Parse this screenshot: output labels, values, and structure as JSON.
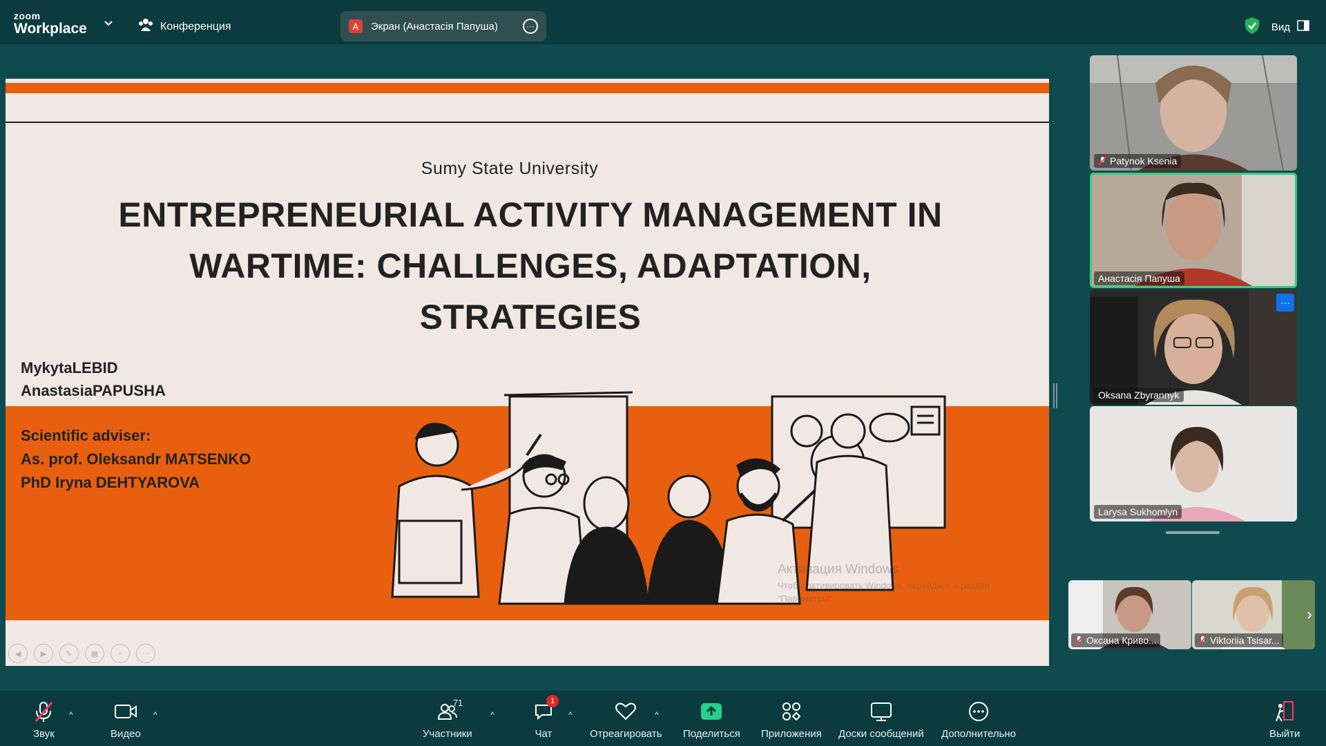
{
  "app": {
    "logo_small": "zoom",
    "logo_big": "Workplace",
    "meeting_label": "Конференция"
  },
  "screen_share": {
    "badge": "A",
    "label": "Экран (Анастасія Папуша)"
  },
  "top_right": {
    "view_label": "Вид"
  },
  "slide": {
    "university": "Sumy State University",
    "title_lines": [
      "ENTREPRENEURIAL ACTIVITY MANAGEMENT IN",
      "WARTIME: CHALLENGES, ADAPTATION,",
      "STRATEGIES"
    ],
    "authors": [
      "MykytaLEBID",
      "AnastasiaPAPUSHA"
    ],
    "advisers": [
      "Scientific adviser:",
      "As. prof. Oleksandr MATSENKO",
      "PhD Iryna DEHTYAROVA"
    ],
    "watermark_title": "Активация Windows",
    "watermark_sub": "Чтобы активировать Windows, перейдите в раздел",
    "watermark_sub2": "\"Параметры\"."
  },
  "participants": [
    {
      "name": "Patynok Ksenia",
      "muted": true
    },
    {
      "name": "Анастасія Папуша",
      "muted": false,
      "active": true
    },
    {
      "name": "Oksana Zbyrannyk",
      "muted": false
    },
    {
      "name": "Larysa Sukhomlyn",
      "muted": false
    }
  ],
  "strip": [
    {
      "name": "Оксана Криво...",
      "muted": true
    },
    {
      "name": "Viktoriia Tsisar...",
      "muted": true
    }
  ],
  "toolbar": {
    "audio": "Звук",
    "video": "Видео",
    "participants": "Участники",
    "participants_count": "71",
    "chat": "Чат",
    "chat_badge": "1",
    "react": "Отреагировать",
    "share": "Поделиться",
    "apps": "Приложения",
    "whiteboards": "Доски сообщений",
    "more": "Дополнительно",
    "leave": "Выйти"
  },
  "colors": {
    "accent_orange": "#e8600f",
    "slide_bg": "#f2e8e3",
    "active_speaker": "#33d17a",
    "share_green": "#23d18b",
    "chat_badge": "#e02828"
  }
}
